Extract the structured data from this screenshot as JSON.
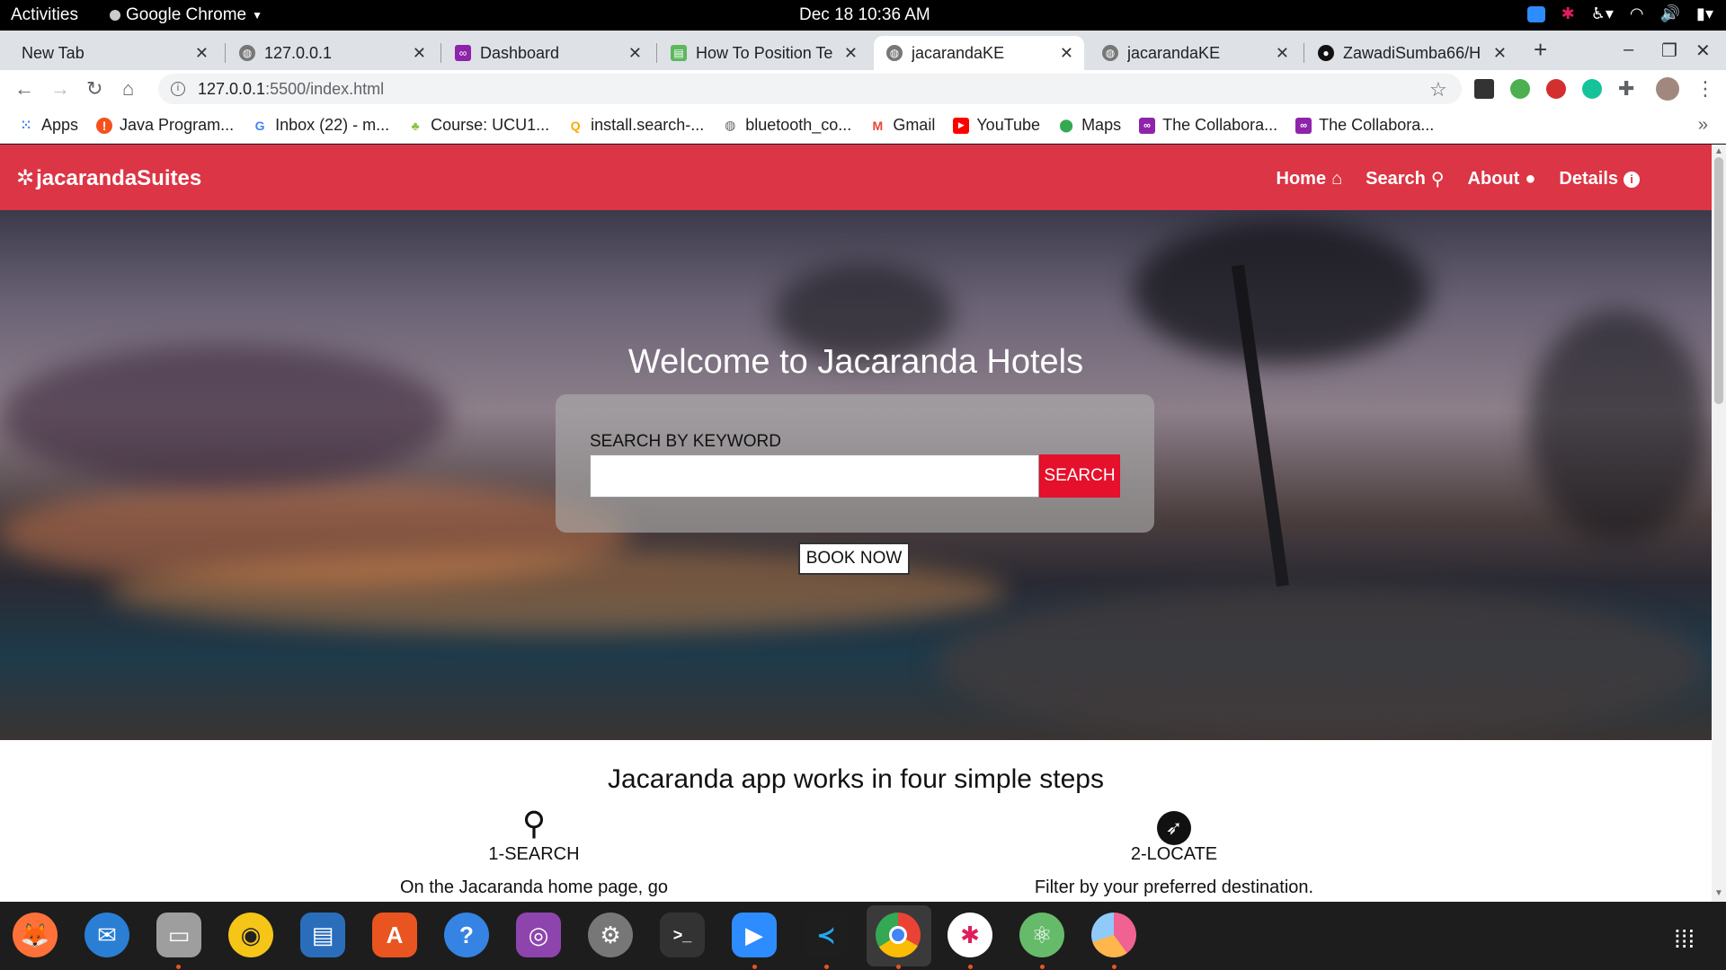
{
  "topbar": {
    "activities": "Activities",
    "app": "Google Chrome",
    "clock": "Dec 18  10:36 AM"
  },
  "tabs": [
    {
      "title": "New Tab",
      "active": false
    },
    {
      "title": "127.0.0.1",
      "active": false
    },
    {
      "title": "Dashboard",
      "active": false
    },
    {
      "title": "How To Position Te",
      "active": false
    },
    {
      "title": "jacarandaKE",
      "active": true
    },
    {
      "title": "jacarandaKE",
      "active": false
    },
    {
      "title": "ZawadiSumba66/H",
      "active": false
    }
  ],
  "omnibox": {
    "host": "127.0.0.1",
    "path": ":5500/index.html"
  },
  "bookmarks": [
    {
      "label": "Apps",
      "icon": "apps-grid-icon",
      "color": "#4285f4"
    },
    {
      "label": "Java Program...",
      "icon": "java-icon",
      "color": "#f4511e"
    },
    {
      "label": "Inbox (22) - m...",
      "icon": "google-icon",
      "color": "#4285f4"
    },
    {
      "label": "Course: UCU1...",
      "icon": "course-icon",
      "color": "#8bc34a"
    },
    {
      "label": "install.search-...",
      "icon": "search-site-icon",
      "color": "#f9ab00"
    },
    {
      "label": "bluetooth_co...",
      "icon": "globe-icon",
      "color": "#5f6368"
    },
    {
      "label": "Gmail",
      "icon": "gmail-icon",
      "color": "#ea4335"
    },
    {
      "label": "YouTube",
      "icon": "youtube-icon",
      "color": "#ff0000"
    },
    {
      "label": "Maps",
      "icon": "maps-icon",
      "color": "#34a853"
    },
    {
      "label": "The Collabora...",
      "icon": "collab-icon",
      "color": "#8e24aa"
    },
    {
      "label": "The Collabora...",
      "icon": "collab-icon",
      "color": "#8e24aa"
    }
  ],
  "site": {
    "brand": "jacarandaSuites",
    "nav": [
      "Home",
      "Search",
      "About",
      "Details"
    ],
    "hero_title": "Welcome to Jacaranda Hotels",
    "search_label": "SEARCH BY KEYWORD",
    "search_value": "",
    "search_button": "SEARCH",
    "book_now": "BOOK NOW",
    "steps_title": "Jacaranda app works in four simple steps",
    "steps": [
      {
        "name": "1-SEARCH",
        "desc": "On the Jacaranda home page, go",
        "icon": "search-icon"
      },
      {
        "name": "2-LOCATE",
        "desc": "Filter by your preferred destination.",
        "icon": "compass-icon"
      }
    ],
    "accent": "#dc3545"
  },
  "dock": [
    {
      "name": "firefox",
      "color": "#ff7139",
      "running": true
    },
    {
      "name": "thunderbird",
      "color": "#2a7fd4",
      "running": false
    },
    {
      "name": "files",
      "color": "#9e9e9e",
      "running": true
    },
    {
      "name": "rhythmbox",
      "color": "#f5c518",
      "running": false
    },
    {
      "name": "libreoffice-writer",
      "color": "#2a6ebb",
      "running": false
    },
    {
      "name": "ubuntu-software",
      "color": "#e95420",
      "running": false
    },
    {
      "name": "help",
      "color": "#3584e4",
      "running": false
    },
    {
      "name": "cheese",
      "color": "#8e44ad",
      "running": false
    },
    {
      "name": "settings",
      "color": "#777777",
      "running": false
    },
    {
      "name": "terminal",
      "color": "#333333",
      "running": false
    },
    {
      "name": "zoom",
      "color": "#2d8cff",
      "running": true
    },
    {
      "name": "vscode",
      "color": "#23a9f2",
      "running": true
    },
    {
      "name": "chrome",
      "color": "#4285f4",
      "running": true
    },
    {
      "name": "slack",
      "color": "#ffffff",
      "running": true
    },
    {
      "name": "atom",
      "color": "#66bb6a",
      "running": true
    },
    {
      "name": "pie-app",
      "color": "#f06292",
      "running": true
    }
  ]
}
